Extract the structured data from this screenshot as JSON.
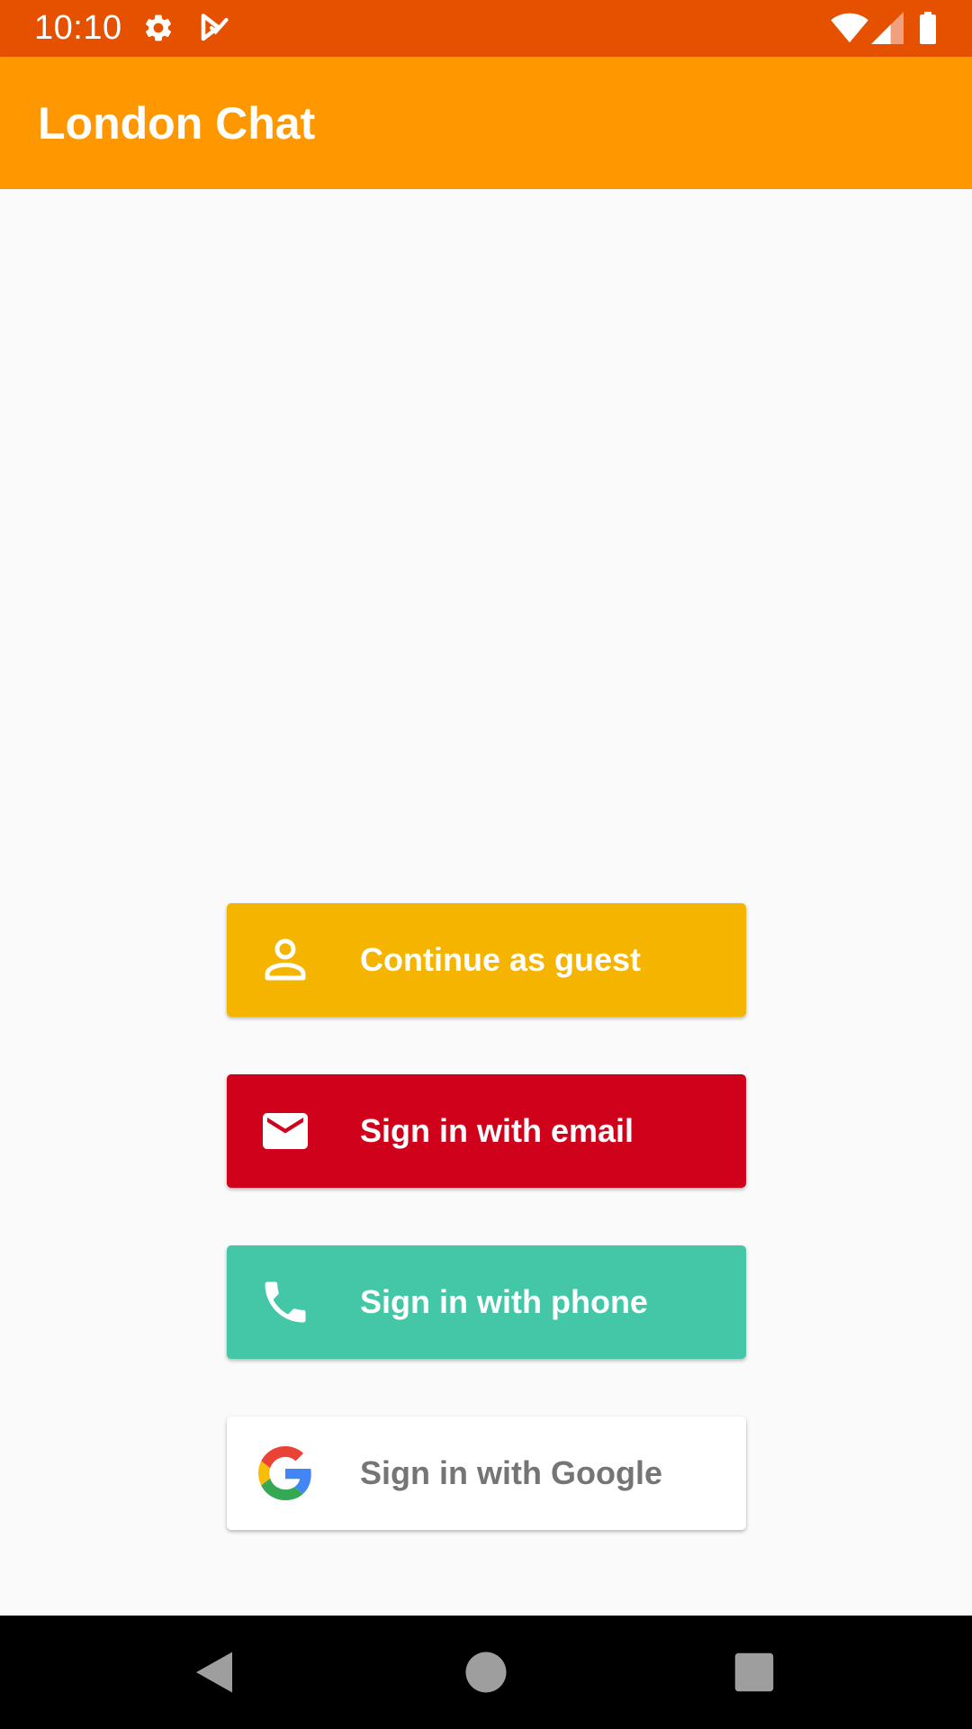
{
  "status_bar": {
    "time": "10:10",
    "color": "#e65100",
    "icons": [
      "gear-icon",
      "task-check-icon",
      "wifi-icon",
      "cell-signal-icon",
      "battery-icon"
    ]
  },
  "app_bar": {
    "title": "London Chat",
    "color": "#ff9800"
  },
  "auth_buttons": [
    {
      "label": "Continue as guest",
      "icon": "person-icon",
      "color": "#f4b400",
      "text_color": "#ffffff"
    },
    {
      "label": "Sign in with email",
      "icon": "mail-icon",
      "color": "#d0021b",
      "text_color": "#ffffff"
    },
    {
      "label": "Sign in with phone",
      "icon": "phone-icon",
      "color": "#44c7a6",
      "text_color": "#ffffff"
    },
    {
      "label": "Sign in with Google",
      "icon": "google-logo-icon",
      "color": "#ffffff",
      "text_color": "#757575"
    }
  ],
  "nav_bar": {
    "buttons": [
      "back-icon",
      "home-icon",
      "recents-icon"
    ]
  }
}
